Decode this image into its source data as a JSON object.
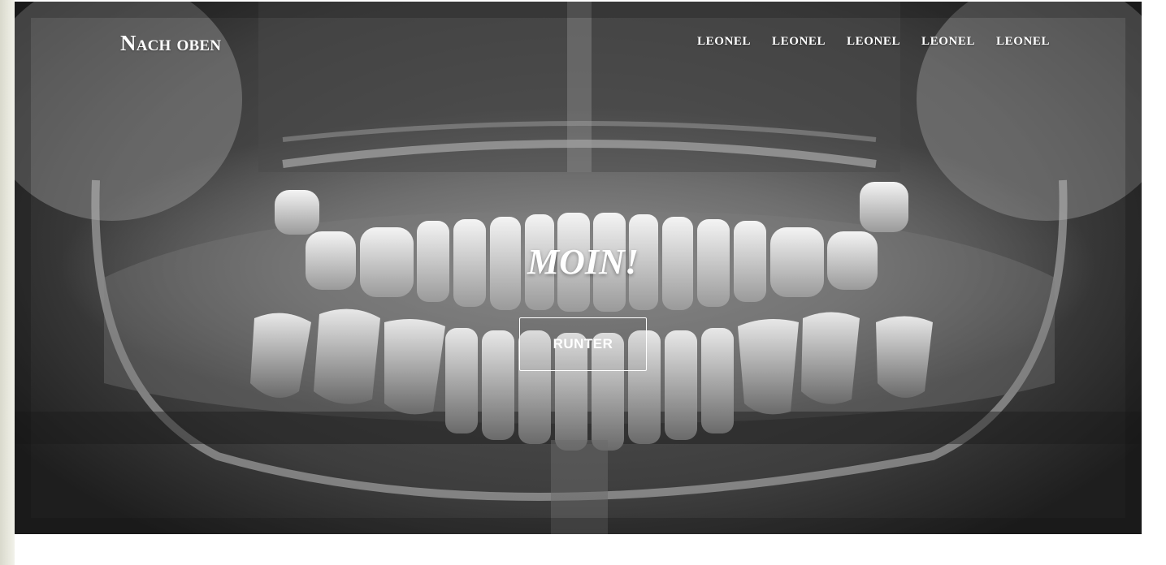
{
  "nav": {
    "brand": "Nach oben",
    "links": [
      "LEONEL",
      "LEONEL",
      "LEONEL",
      "LEONEL",
      "LEONEL"
    ]
  },
  "hero": {
    "title": "MOIN!",
    "button_label": "RUNTER",
    "background_image": "dental-panoramic-xray"
  },
  "colors": {
    "text": "#ffffff",
    "page_background": "#ffffff"
  }
}
